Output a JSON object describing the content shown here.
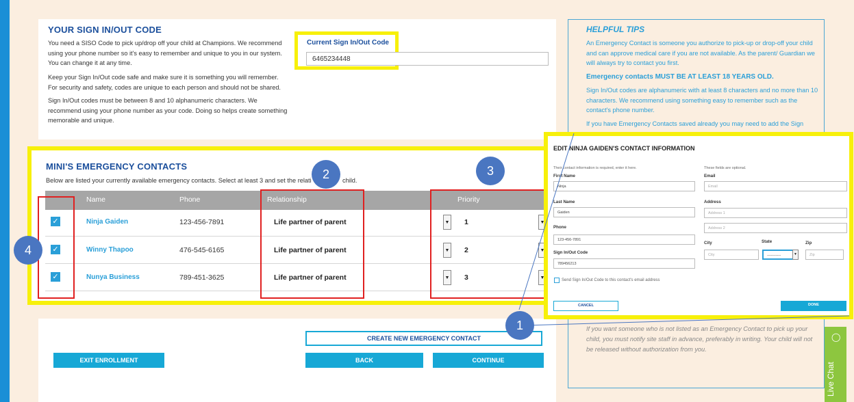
{
  "sign_in_code": {
    "title": "YOUR SIGN IN/OUT CODE",
    "paragraph_1": "You need a SISO Code to pick up/drop off your child at Champions. We recommend using your phone number so it's easy to remember and unique to you in our system. You can change it at any time.",
    "paragraph_2": "Keep your Sign In/Out code safe and make sure it is something you will remember. For security and safety, codes are unique to each person and should not be shared.",
    "paragraph_3": "Sign In/Out codes must be between 8 and 10 alphanumeric characters. We recommend using your phone number as your code. Doing so helps create something memorable and unique.",
    "current_label": "Current Sign In/Out Code",
    "current_value": "6465234448"
  },
  "contacts": {
    "title": "MINI'S EMERGENCY CONTACTS",
    "description": "Below are listed your currently available emergency contacts. Select at least 3 and set the relati",
    "description_tail": "child.",
    "columns": [
      "Name",
      "Phone",
      "Relationship",
      "Priority"
    ],
    "rows": [
      {
        "name": "Ninja Gaiden",
        "phone": "123-456-7891",
        "relationship": "Life partner of parent",
        "priority": "1"
      },
      {
        "name": "Winny Thapoo",
        "phone": "476-545-6165",
        "relationship": "Life partner of parent",
        "priority": "2"
      },
      {
        "name": "Nunya Business",
        "phone": "789-451-3625",
        "relationship": "Life partner of parent",
        "priority": "3"
      }
    ]
  },
  "markers": [
    "1",
    "2",
    "3",
    "4"
  ],
  "actions": {
    "create": "CREATE NEW EMERGENCY CONTACT",
    "exit": "EXIT ENROLLMENT",
    "back": "BACK",
    "continue": "CONTINUE"
  },
  "tips": {
    "title": "HELPFUL TIPS",
    "tip_1": "An Emergency Contact is someone you authorize to pick-up or drop-off your child and can approve medical care if you are not available. As the parent/ Guardian we will always try to contact you first.",
    "tip_2": "Emergency contacts MUST BE AT LEAST 18 YEARS OLD.",
    "tip_3": "Sign In/Out codes are alphanumeric with at least 8 characters and no more than 10 characters. We recommend using something easy to remember such as the contact's phone number.",
    "tip_4": "If you have Emergency Contacts saved already you may need to add the Sign",
    "tip_5": "If you want someone who is not listed as an Emergency Contact to pick up your child, you must notify site staff in advance, preferably in writing. Your child will not be released without authorization from you."
  },
  "modal": {
    "title": "EDIT NINJA GAIDEN'S CONTACT INFORMATION",
    "required_note": "Their contact information is required, enter it here.",
    "optional_note": "These fields are optional.",
    "first_name_label": "First Name",
    "first_name_value": "Ninja",
    "last_name_label": "Last Name",
    "last_name_value": "Gaiden",
    "phone_label": "Phone",
    "phone_value": "123-456-7891",
    "code_label": "Sign In/Out Code",
    "code_value": "789456213",
    "email_label": "Email",
    "email_placeholder": "Email",
    "address_label": "Address",
    "address1_placeholder": "Address 1",
    "address2_placeholder": "Address 2",
    "city_label": "City",
    "city_placeholder": "City",
    "state_label": "State",
    "state_value": "-----------",
    "zip_label": "Zip",
    "zip_placeholder": "Zip",
    "send_code_label": "Send Sign In/Out Code to this contact's email address",
    "cancel": "CANCEL",
    "done": "DONE"
  },
  "live_chat": {
    "label": "Live Chat",
    "icon": "chat-bubble-icon"
  },
  "colors": {
    "accent": "#17a8d6",
    "brand_blue": "#1b4f9c",
    "highlight": "#f7f00a",
    "annotation_red": "#e02020",
    "marker": "#4a76c1",
    "chat": "#8dc63f"
  }
}
